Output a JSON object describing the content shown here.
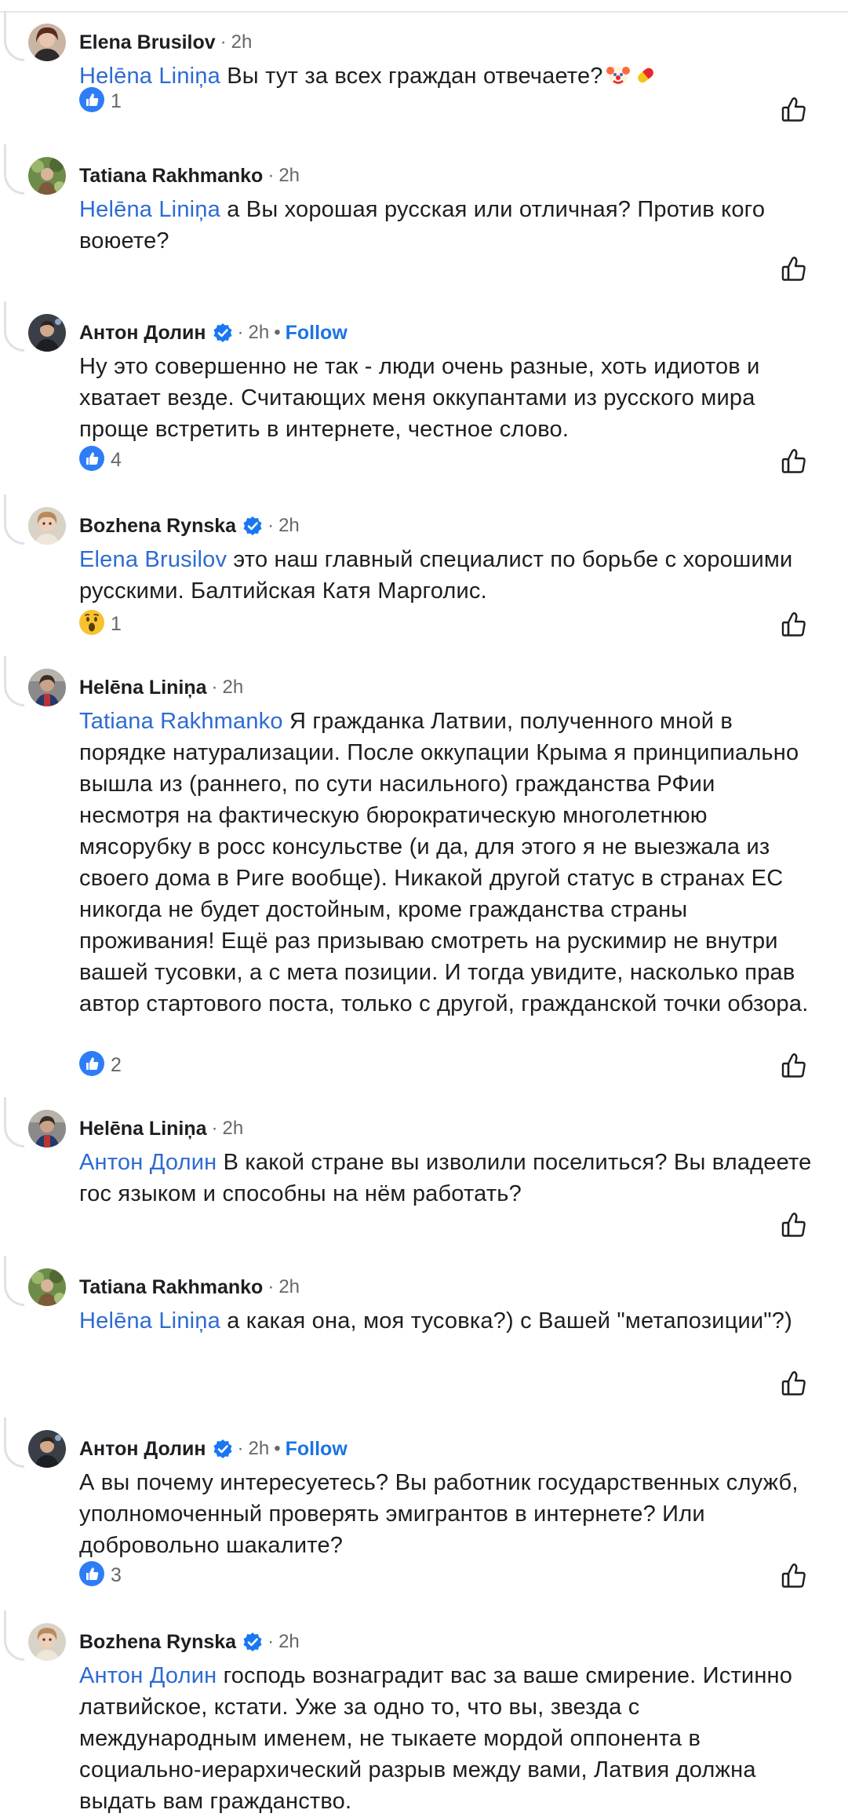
{
  "comments": [
    {
      "author": "Elena Brusilov",
      "verified": false,
      "time": "2h",
      "mention": "Helēna Liniņa",
      "text": " Вы тут за всех граждан отвечаете?",
      "emojis": [
        "clown-face",
        "pill"
      ],
      "reaction": {
        "type": "like",
        "count": "1"
      }
    },
    {
      "author": "Tatiana Rakhmanko",
      "verified": false,
      "time": "2h",
      "mention": "Helēna Liniņa",
      "text": " а Вы хорошая русская или отличная? Против кого воюете?",
      "reaction": null
    },
    {
      "author": "Антон Долин",
      "verified": true,
      "time": "2h",
      "follow": "Follow",
      "mention": "",
      "text": "Ну это совершенно не так - люди очень разные, хоть идиотов и хватает везде. Считающих меня оккупантами из русского мира проще встретить в интернете, честное слово.",
      "reaction": {
        "type": "like",
        "count": "4"
      }
    },
    {
      "author": "Bozhena  Rynska",
      "verified": true,
      "time": "2h",
      "mention": "Elena Brusilov",
      "text": " это наш главный специалист по борьбе с хорошими русскими. Балтийская Катя Марголис.",
      "reaction": {
        "type": "wow",
        "count": "1"
      }
    },
    {
      "author": "Helēna Liniņa",
      "verified": false,
      "time": "2h",
      "mention": "Tatiana Rakhmanko",
      "text": " Я гражданка Латвии, полученного мной в порядке натурализации. После оккупации Крыма я принципиально вышла из (раннего, по сути насильного) гражданства РФии несмотря на фактическую бюрократическую многолетнюю мясорубку в росс консульстве (и да, для этого я не выезжала из своего дома в Риге вообще). Никакой другой статус в странах ЕС никогда не будет достойным, кроме гражданства страны проживания! Ещё раз призываю смотреть на рускимир не внутри вашей тусовки, а с мета позиции. И тогда увидите, насколько прав автор стартового поста, только с другой, гражданской точки обзора.",
      "reaction": {
        "type": "like",
        "count": "2"
      }
    },
    {
      "author": "Helēna Liniņa",
      "verified": false,
      "time": "2h",
      "mention": "Антон Долин",
      "text": " В какой стране вы изволили поселиться? Вы владеете гос языком и способны на нём работать?",
      "reaction": null
    },
    {
      "author": "Tatiana Rakhmanko",
      "verified": false,
      "time": "2h",
      "mention": "Helēna Liniņa",
      "text": " а какая она, моя тусовка?) с Вашей \"метапозиции\"?)",
      "reaction": null
    },
    {
      "author": "Антон Долин",
      "verified": true,
      "time": "2h",
      "follow": "Follow",
      "mention": "",
      "text": "А вы почему интересуетесь? Вы работник государственных служб, уполномоченный проверять эмигрантов в интернете? Или добровольно шакалите?",
      "reaction": {
        "type": "like",
        "count": "3"
      }
    },
    {
      "author": "Bozhena  Rynska",
      "verified": true,
      "time": "2h",
      "mention": "Антон Долин",
      "text": " господь вознаградит вас за ваше смирение. Истинно латвийское, кстати. Уже за одно то, что вы, звезда с международным именем, не тыкаете мордой оппонента в социально-иерархический разрыв между вами, Латвия должна выдать вам гражданство.",
      "reaction": null
    }
  ],
  "colors": {
    "link": "#2d6bd3",
    "follow": "#1b74e4",
    "meta": "#65676b",
    "thread_line": "#dfe1e5"
  }
}
